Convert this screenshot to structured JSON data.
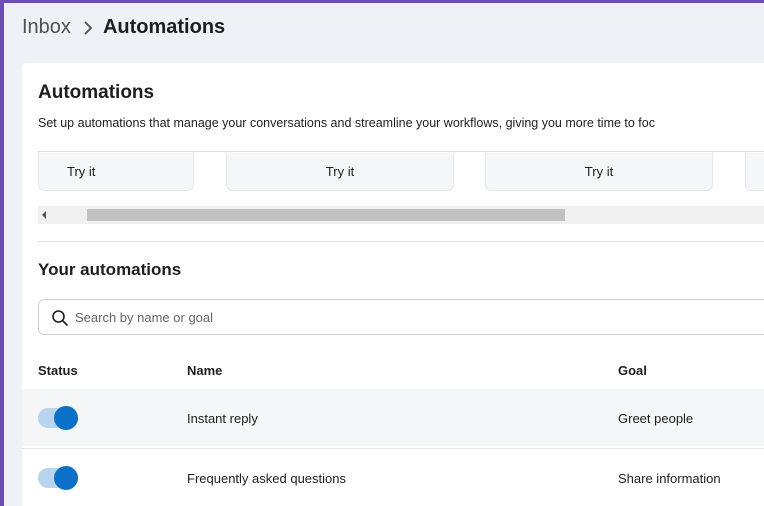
{
  "breadcrumb": {
    "parent": "Inbox",
    "current": "Automations"
  },
  "card": {
    "title": "Automations",
    "description": "Set up automations that manage your conversations and streamline your workflows, giving you more time to foc",
    "try_buttons": [
      "Try it",
      "Try it",
      "Try it",
      ""
    ]
  },
  "your_automations": {
    "title": "Your automations",
    "search": {
      "placeholder": "Search by name or goal",
      "value": ""
    },
    "columns": {
      "status": "Status",
      "name": "Name",
      "goal": "Goal"
    },
    "rows": [
      {
        "status": "on",
        "name": "Instant reply",
        "goal": "Greet people"
      },
      {
        "status": "on",
        "name": "Frequently asked questions",
        "goal": "Share information"
      }
    ]
  },
  "colors": {
    "accent": "#0a70c8",
    "toggle_track": "#b8d4ef",
    "frame": "#6d4fb3",
    "page_bg": "#eef1f6"
  },
  "icons": {
    "search": "search-icon",
    "breadcrumb_separator": "chevron-right-icon",
    "scroll_left": "arrow-left-icon"
  }
}
